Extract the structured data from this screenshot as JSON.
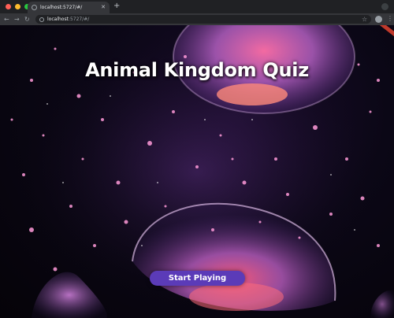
{
  "browser": {
    "tab_title": "localhost:5727/#/",
    "tab_close_icon": "close-icon",
    "new_tab_icon": "plus-icon",
    "url_host": "localhost",
    "url_rest": ":5727/#/",
    "icons": [
      "back-arrow-icon",
      "forward-arrow-icon",
      "reload-icon",
      "info-icon",
      "star-icon",
      "profile-icon",
      "kebab-menu-icon"
    ]
  },
  "page": {
    "title": "Animal Kingdom Quiz",
    "start_button_label": "Start Playing",
    "accent_color": "#5b3bb8",
    "background": "jellyfish-photo"
  }
}
